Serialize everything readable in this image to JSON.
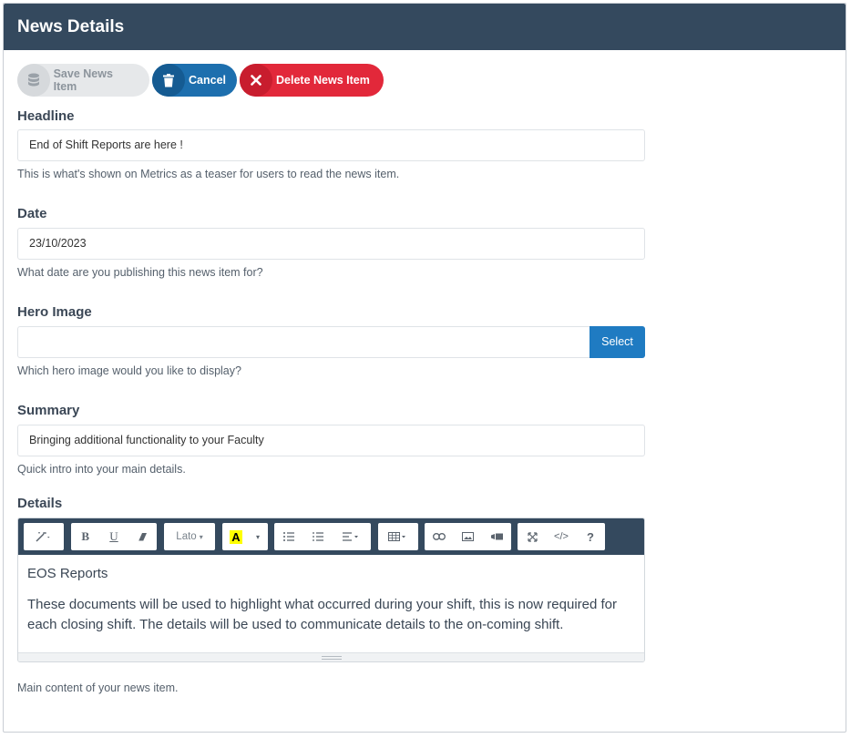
{
  "panel": {
    "title": "News Details"
  },
  "toolbar": {
    "save_label": "Save News Item",
    "cancel_label": "Cancel",
    "delete_label": "Delete News Item"
  },
  "headline": {
    "label": "Headline",
    "value": "End of Shift Reports are here !",
    "help": "This is what's shown on Metrics as a teaser for users to read the news item."
  },
  "date": {
    "label": "Date",
    "value": "23/10/2023",
    "help": "What date are you publishing this news item for?"
  },
  "hero_image": {
    "label": "Hero Image",
    "value": "",
    "select_label": "Select",
    "help": "Which hero image would you like to display?"
  },
  "summary": {
    "label": "Summary",
    "value": "Bringing additional functionality to your Faculty",
    "help": "Quick intro into your main details."
  },
  "details": {
    "label": "Details",
    "help": "Main content of your news item.",
    "editor": {
      "font_name": "Lato",
      "heading": "EOS Reports",
      "body": "These documents will be used to highlight what occurred during your shift, this is now required for each closing shift. The details will be used to communicate details to the on-coming shift."
    }
  },
  "colors": {
    "header_bg": "#34495e",
    "cancel": "#1d6fae",
    "delete": "#e2283a",
    "select": "#1f7bc2"
  }
}
